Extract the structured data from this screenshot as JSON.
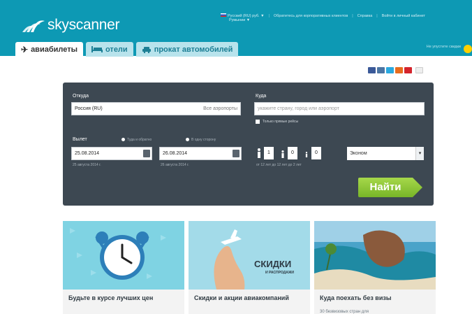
{
  "header": {
    "logo_text": "skyscanner",
    "lang_currency": "Русский (RU) руб. ▼",
    "country": "Румынии ▼",
    "link_business": "Обратитесь для корпоративных клиентов",
    "link_help": "Справка",
    "link_login": "Войти в личный кабинет",
    "right_link": "Не упустите скидки"
  },
  "tabs": [
    {
      "label": "авиабилеты",
      "icon": "plane-icon",
      "active": true
    },
    {
      "label": "отели",
      "icon": "bed-icon",
      "active": false
    },
    {
      "label": "прокат автомобилей",
      "icon": "car-icon",
      "active": false
    }
  ],
  "search": {
    "from_label": "Откуда",
    "from_value": "Россия (RU)",
    "from_hint": "Все аэропорты",
    "to_label": "Куда",
    "to_placeholder": "укажите страну, город или аэропорт",
    "direct_only": "Только прямые рейсы",
    "depart_label": "Вылет",
    "radio_roundtrip": "Туда и обратно",
    "radio_oneway": "В одну сторону",
    "depart_date": "25.08.2014",
    "depart_sub": "25 августа 2014 г.",
    "return_date": "26.08.2014",
    "return_sub": "26 августа 2014 г.",
    "adults": "1",
    "children": "0",
    "infants": "0",
    "pax_sub": "от 12 лет   до 12 лет   до 2 лет",
    "cabin": "Эконом",
    "search_button": "Найти"
  },
  "cards": [
    {
      "title": "Будьте в курсе лучших цен",
      "subtitle": ""
    },
    {
      "title": "Скидки и акции авиакомпаний",
      "subtitle": "",
      "image_text": "СКИДКИ",
      "image_sub": "И РАСПРОДАЖИ"
    },
    {
      "title": "Куда поехать без визы",
      "subtitle": "30 безвизовых стран для"
    }
  ],
  "colors": {
    "header_bg": "#0d99b4",
    "panel_bg": "#3d4852",
    "search_green": "#8cc63f"
  }
}
